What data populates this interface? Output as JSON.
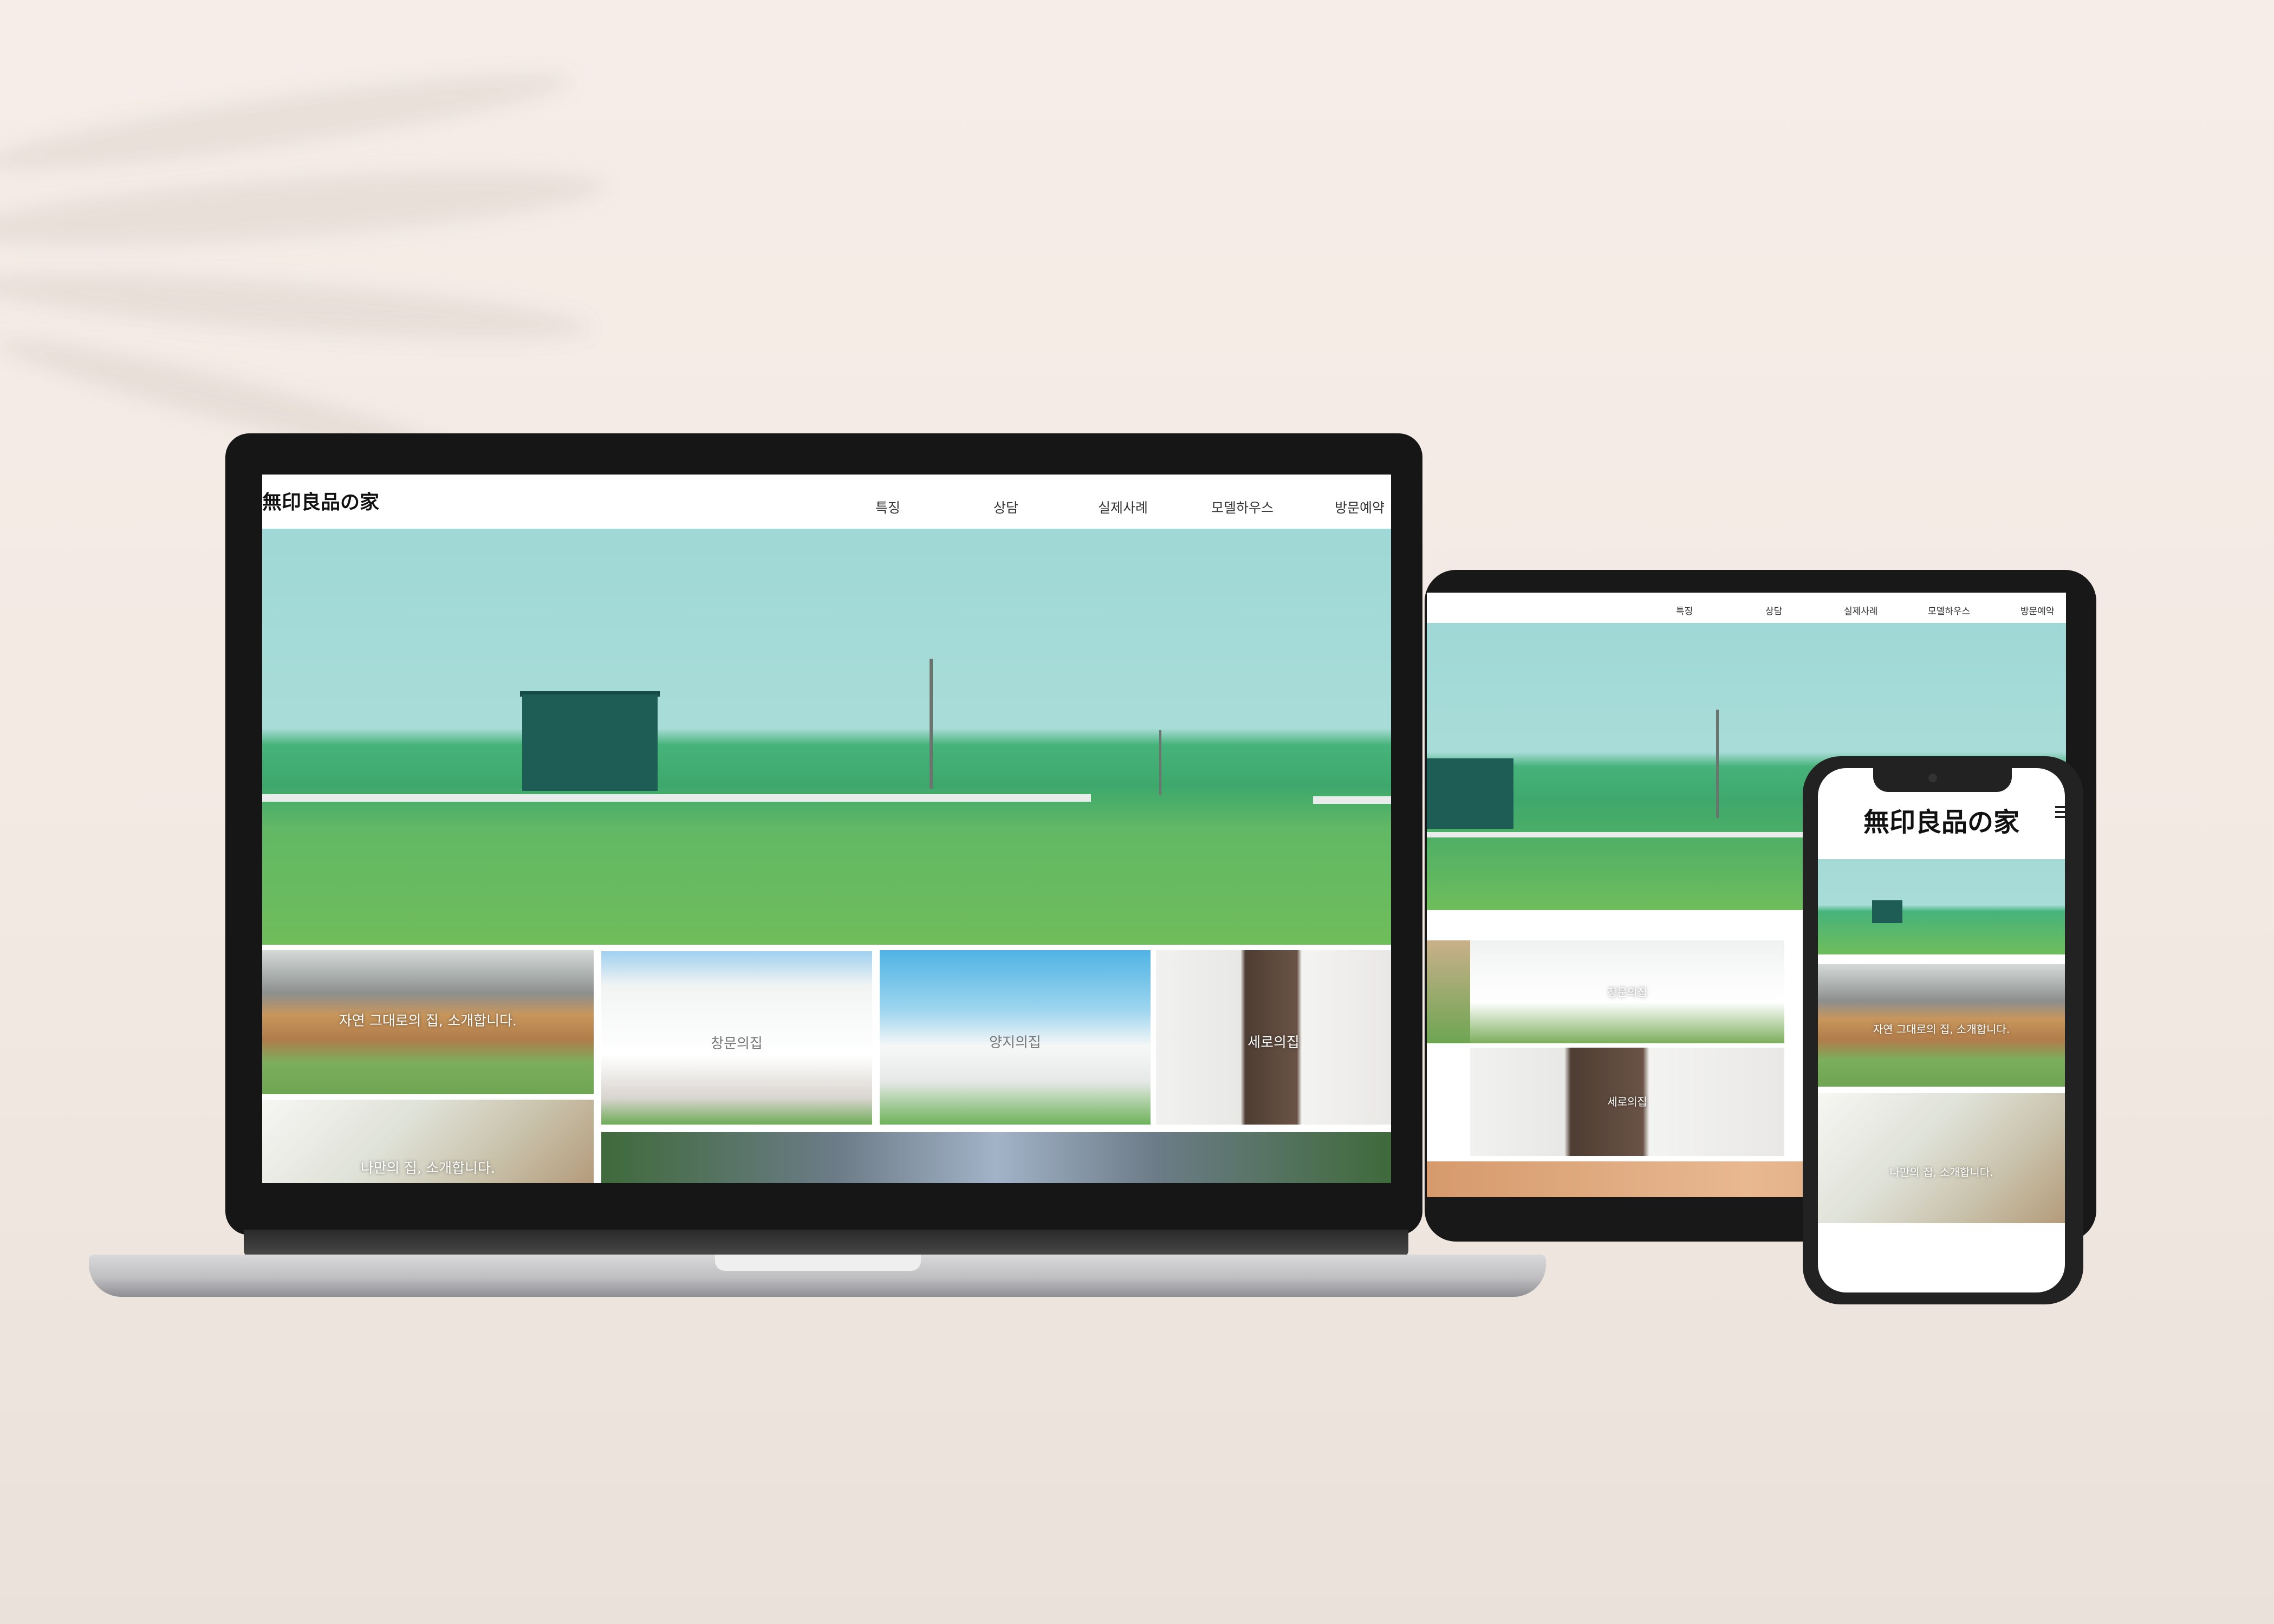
{
  "brand": {
    "logo": "無印良品の家"
  },
  "nav": [
    "특징",
    "상담",
    "실제사례",
    "모델하우스",
    "방문예약"
  ],
  "tiles": {
    "nature": "자연 그대로의 집, 소개합니다.",
    "window": "창문의집",
    "sunny": "양지의집",
    "vertical": "세로의집",
    "mine": "나만의 집, 소개합니다."
  },
  "colors": {
    "background": "#f4ebe5",
    "sky": "#a8dcd8",
    "field": "#3ea86c",
    "house": "#1e5d56"
  }
}
